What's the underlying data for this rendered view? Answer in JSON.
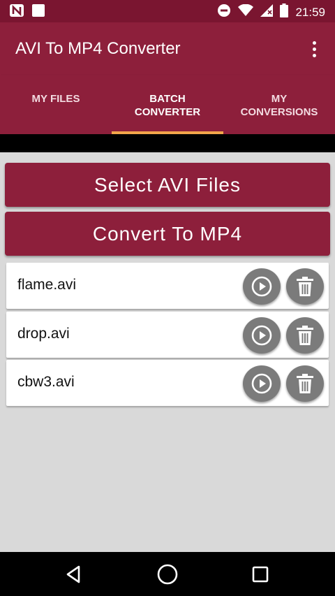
{
  "status_bar": {
    "time": "21:59",
    "left_icons": [
      "n-notification-icon",
      "square-notification-icon"
    ],
    "right_icons": [
      "do-not-disturb-icon",
      "wifi-icon",
      "no-signal-icon",
      "battery-icon"
    ]
  },
  "app_bar": {
    "title": "AVI To MP4 Converter",
    "overflow_icon": "more-vert-icon"
  },
  "tabs": [
    {
      "label": "MY FILES",
      "active": false
    },
    {
      "label": "BATCH\nCONVERTER",
      "active": true
    },
    {
      "label": "MY\nCONVERSIONS",
      "active": false
    }
  ],
  "actions": {
    "select_label": "Select AVI Files",
    "convert_label": "Convert To MP4"
  },
  "files": [
    {
      "name": "flame.avi"
    },
    {
      "name": "drop.avi"
    },
    {
      "name": "cbw3.avi"
    }
  ],
  "nav_bar": {
    "buttons": [
      "back-icon",
      "home-icon",
      "recents-icon"
    ]
  },
  "colors": {
    "primary": "#8d1f3b",
    "primary_dark": "#7a1530",
    "tab_indicator": "#f2a54a",
    "circle_button": "#7b7b7b",
    "background": "#d9d9d9"
  }
}
